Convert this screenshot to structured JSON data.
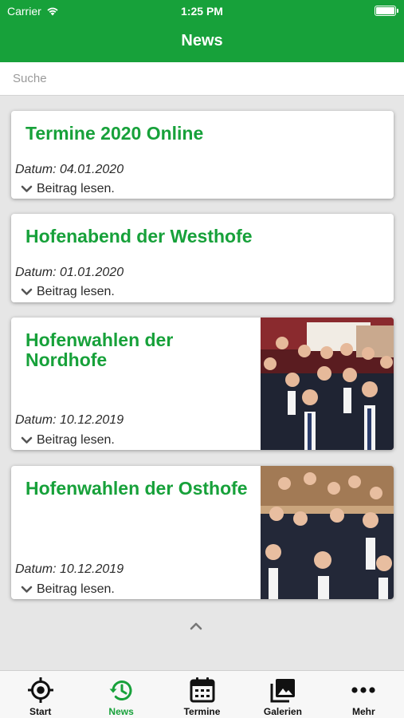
{
  "status_bar": {
    "carrier": "Carrier",
    "time": "1:25 PM"
  },
  "header": {
    "title": "News"
  },
  "search": {
    "placeholder": "Suche",
    "value": ""
  },
  "news": [
    {
      "title": "Termine 2020 Online",
      "date": "Datum: 04.01.2020",
      "more": "Beitrag lesen."
    },
    {
      "title": "Hofenabend der Westhofe",
      "date": "Datum: 01.01.2020",
      "more": "Beitrag lesen."
    },
    {
      "title": "Hofenwahlen der Nordhofe",
      "date": "Datum: 10.12.2019",
      "more": "Beitrag lesen."
    },
    {
      "title": "Hofenwahlen der Osthofe",
      "date": "Datum: 10.12.2019",
      "more": "Beitrag lesen."
    }
  ],
  "tabs": [
    {
      "label": "Start",
      "icon": "crosshair-icon"
    },
    {
      "label": "News",
      "icon": "history-icon",
      "active": true
    },
    {
      "label": "Termine",
      "icon": "calendar-icon"
    },
    {
      "label": "Galerien",
      "icon": "gallery-icon"
    },
    {
      "label": "Mehr",
      "icon": "more-dots-icon"
    }
  ],
  "colors": {
    "brand_green": "#17a13a",
    "background": "#e6e6e6",
    "card": "#ffffff"
  }
}
